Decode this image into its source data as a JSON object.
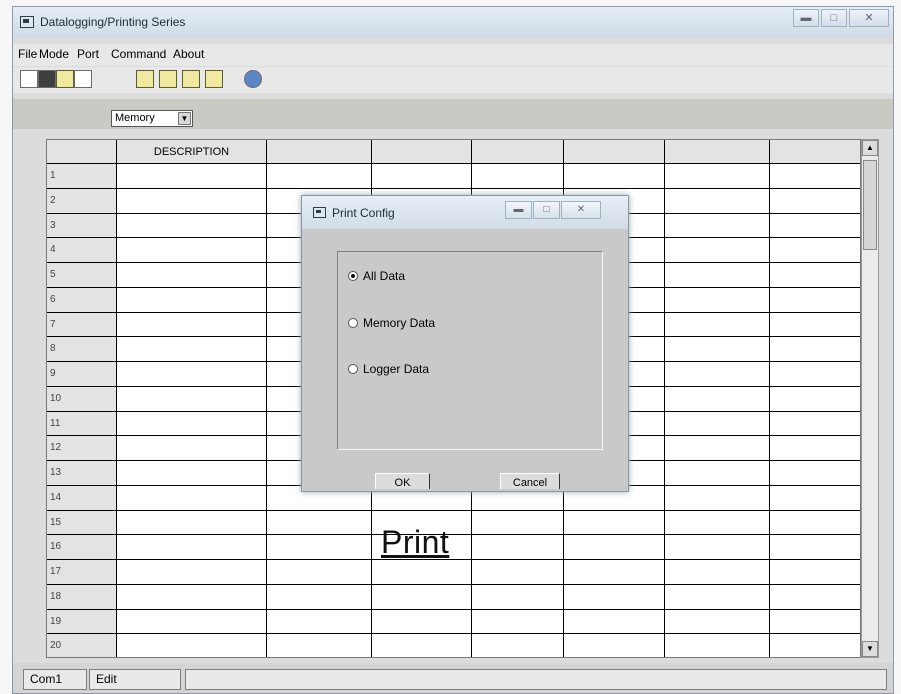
{
  "window": {
    "title": "Datalogging/Printing Series",
    "caption_buttons": [
      "minimize",
      "maximize",
      "close"
    ]
  },
  "menu": {
    "items": [
      "File",
      "Mode",
      "Port",
      "Command",
      "About"
    ]
  },
  "toolbar": {
    "icons": [
      "new-file-icon",
      "save-icon",
      "open-folder-icon",
      "print-icon",
      "export-icon",
      "import-icon",
      "merge-icon",
      "memory-icon",
      "help-icon"
    ]
  },
  "mode_select": {
    "value": "Memory"
  },
  "grid": {
    "column_headers": [
      "DESCRIPTION",
      "",
      "",
      "",
      "",
      "",
      ""
    ],
    "row_numbers": [
      "1",
      "2",
      "3",
      "4",
      "5",
      "6",
      "7",
      "8",
      "9",
      "10",
      "11",
      "12",
      "13",
      "14",
      "15",
      "16",
      "17",
      "18",
      "19",
      "20"
    ]
  },
  "dialog": {
    "title": "Print Config",
    "options": [
      {
        "label": "All Data",
        "selected": true
      },
      {
        "label": "Memory Data",
        "selected": false
      },
      {
        "label": "Logger Data",
        "selected": false
      }
    ],
    "ok_label": "OK",
    "cancel_label": "Cancel"
  },
  "print_label": "Print",
  "statusbar": {
    "tabs": [
      "Com1",
      "Edit"
    ]
  }
}
